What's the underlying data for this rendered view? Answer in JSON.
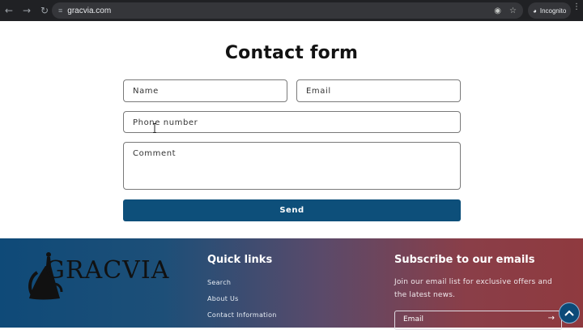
{
  "browser": {
    "url": "gracvia.com",
    "incognito_label": "Incognito"
  },
  "contact": {
    "title": "Contact form",
    "name_placeholder": "Name",
    "email_placeholder": "Email",
    "phone_placeholder": "Phone number",
    "comment_placeholder": "Comment",
    "send_label": "Send"
  },
  "footer": {
    "logo_text": "GRACVIA",
    "quick_links_title": "Quick links",
    "quick_links": [
      "Search",
      "About Us",
      "Contact Information"
    ],
    "subscribe_title": "Subscribe to our emails",
    "subscribe_text": "Join our email list for exclusive offers and the latest news.",
    "email_placeholder": "Email"
  },
  "colors": {
    "send_button": "#0d4f7a",
    "footer_left": "#0f4a78",
    "footer_right": "#8f3a3f"
  }
}
